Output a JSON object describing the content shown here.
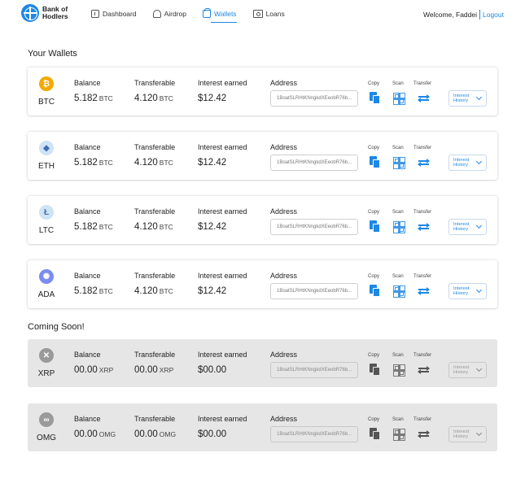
{
  "brand": {
    "name_line1": "Bank of",
    "name_line2": "Hodlers"
  },
  "nav": {
    "items": [
      {
        "label": "Dashboard",
        "icon": "dashboard-icon",
        "active": false
      },
      {
        "label": "Airdrop",
        "icon": "airdrop-icon",
        "active": false
      },
      {
        "label": "Wallets",
        "icon": "wallet-icon",
        "active": true
      },
      {
        "label": "Loans",
        "icon": "loans-icon",
        "active": false
      }
    ]
  },
  "user": {
    "welcome": "Welcome, Faddei",
    "logout": "Logout"
  },
  "sections": {
    "wallets_title": "Your Wallets",
    "soon_title": "Coming Soon!"
  },
  "labels": {
    "balance": "Balance",
    "transferable": "Transferable",
    "interest": "Interest earned",
    "address": "Address",
    "copy": "Copy",
    "scan": "Scan",
    "transfer": "Transfer",
    "history_line1": "Interest",
    "history_line2": "History"
  },
  "wallets": [
    {
      "symbol": "BTC",
      "icon": "bitcoin-icon",
      "icon_color": "#f2a900",
      "glyph": "₿",
      "balance": "5.182",
      "transferable": "4.120",
      "unit": "BTC",
      "interest": "$12.42",
      "address": "1BoatSLRHtKNngkdXEeobR76b..."
    },
    {
      "symbol": "ETH",
      "icon": "ethereum-icon",
      "icon_color": "#cfe3f5",
      "glyph": "◆",
      "balance": "5.182",
      "transferable": "4.120",
      "unit": "BTC",
      "interest": "$12.42",
      "address": "1BoatSLRHtKNngkdXEeobR76b..."
    },
    {
      "symbol": "LTC",
      "icon": "litecoin-icon",
      "icon_color": "#cfe3f5",
      "glyph": "Ł",
      "balance": "5.182",
      "transferable": "4.120",
      "unit": "BTC",
      "interest": "$12.42",
      "address": "1BoatSLRHtKNngkdXEeobR76b..."
    },
    {
      "symbol": "ADA",
      "icon": "cardano-icon",
      "icon_color": "#7b8cf0",
      "glyph": "✺",
      "balance": "5.182",
      "transferable": "4.120",
      "unit": "BTC",
      "interest": "$12.42",
      "address": "1BoatSLRHtKNngkdXEeobR76b..."
    }
  ],
  "coming_soon": [
    {
      "symbol": "XRP",
      "icon": "ripple-icon",
      "icon_color": "#9a9a9a",
      "glyph": "✕",
      "balance": "00.00",
      "transferable": "00.00",
      "unit": "XRP",
      "interest": "$00.00",
      "address": "1BoatSLRHtKNngkdXEeobR76b..."
    },
    {
      "symbol": "OMG",
      "icon": "omisego-icon",
      "icon_color": "#9a9a9a",
      "glyph": "∞",
      "balance": "00.00",
      "transferable": "00.00",
      "unit": "OMG",
      "interest": "$00.00",
      "address": "1BoatSLRHtKNngkdXEeobR76b..."
    }
  ]
}
